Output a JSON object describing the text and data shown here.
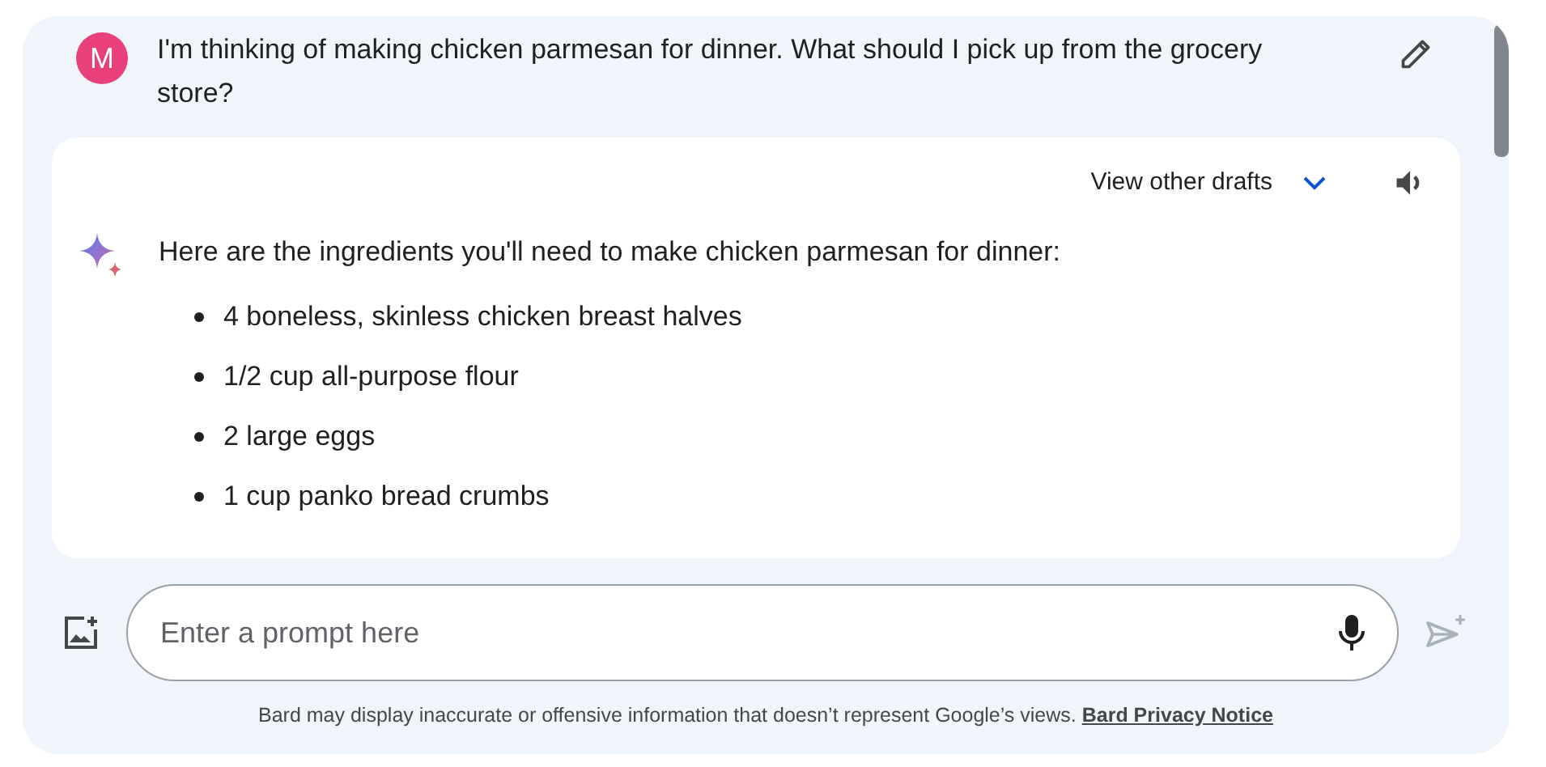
{
  "user_message": {
    "avatar_letter": "M",
    "text": "I'm thinking of making chicken parmesan for dinner. What should I pick up from the grocery store?"
  },
  "response": {
    "drafts_label": "View other drafts",
    "intro": "Here are the ingredients you'll need to make chicken parmesan for dinner:",
    "items": [
      "4 boneless, skinless chicken breast halves",
      "1/2 cup all-purpose flour",
      "2 large eggs",
      "1 cup panko bread crumbs"
    ]
  },
  "prompt": {
    "placeholder": "Enter a prompt here",
    "send_disabled": true
  },
  "disclaimer": {
    "text": "Bard may display inaccurate or offensive information that doesn’t represent Google’s views.",
    "link": "Bard Privacy Notice"
  }
}
